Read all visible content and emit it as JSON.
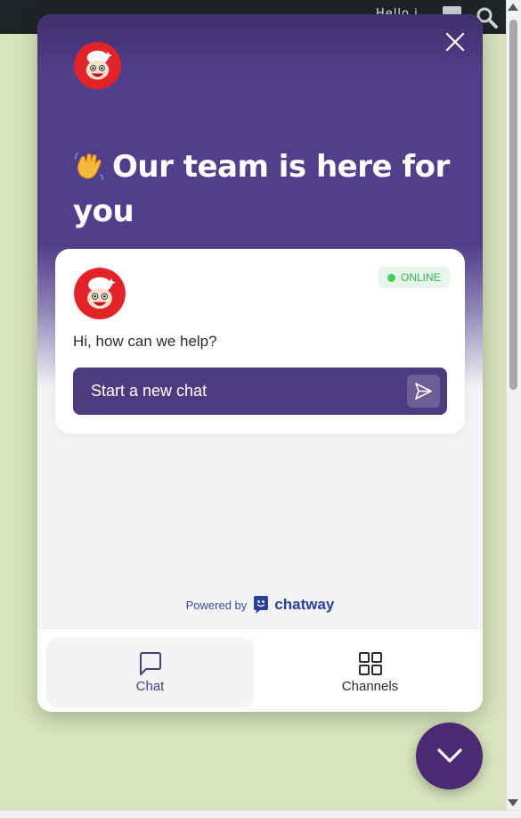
{
  "browser": {
    "topbar_text": "Hello i"
  },
  "widget": {
    "headline_emoji": "👋",
    "headline": "Our team is here for you",
    "card": {
      "status": "ONLINE",
      "greeting": "Hi, how can we help?",
      "start_chat_label": "Start a new chat"
    },
    "powered_by_prefix": "Powered by",
    "powered_by_brand": "chatway",
    "nav": {
      "chat_label": "Chat",
      "channels_label": "Channels"
    }
  },
  "colors": {
    "brand_purple": "#523f8b",
    "button_purple": "#4d3b80",
    "fab_purple": "#4a2a72",
    "online_green": "#3fcf5a",
    "mascot_red": "#e2232a"
  },
  "icons": {
    "close": "close-icon",
    "send": "send-icon",
    "chat": "chat-bubble-icon",
    "channels": "grid-icon",
    "fab": "chevron-down-icon",
    "search": "search-icon"
  }
}
